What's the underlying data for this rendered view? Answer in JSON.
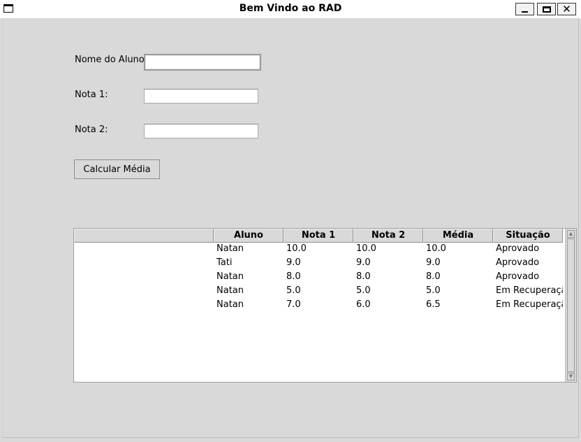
{
  "window": {
    "title": "Bem Vindo ao RAD",
    "icons": {
      "app": "window-icon",
      "minimize": "minimize-icon",
      "maximize": "maximize-icon",
      "close": "close-icon"
    },
    "close_glyph": "✕"
  },
  "form": {
    "nome_label": "Nome do Aluno",
    "nota1_label": "Nota 1:",
    "nota2_label": "Nota 2:",
    "nome_value": "",
    "nota1_value": "",
    "nota2_value": "",
    "calcular_label": "Calcular Média"
  },
  "table": {
    "columns": [
      "",
      "Aluno",
      "Nota 1",
      "Nota 2",
      "Média",
      "Situação"
    ],
    "rows": [
      [
        "",
        "Natan",
        "10.0",
        "10.0",
        "10.0",
        "Aprovado"
      ],
      [
        "",
        "Tati",
        "9.0",
        "9.0",
        "9.0",
        "Aprovado"
      ],
      [
        "",
        "Natan",
        "8.0",
        "8.0",
        "8.0",
        "Aprovado"
      ],
      [
        "",
        "Natan",
        "5.0",
        "5.0",
        "5.0",
        "Em Recuperação"
      ],
      [
        "",
        "Natan",
        "7.0",
        "6.0",
        "6.5",
        "Em Recuperação"
      ]
    ],
    "scroll_up_glyph": "▲",
    "scroll_down_glyph": "▼"
  }
}
